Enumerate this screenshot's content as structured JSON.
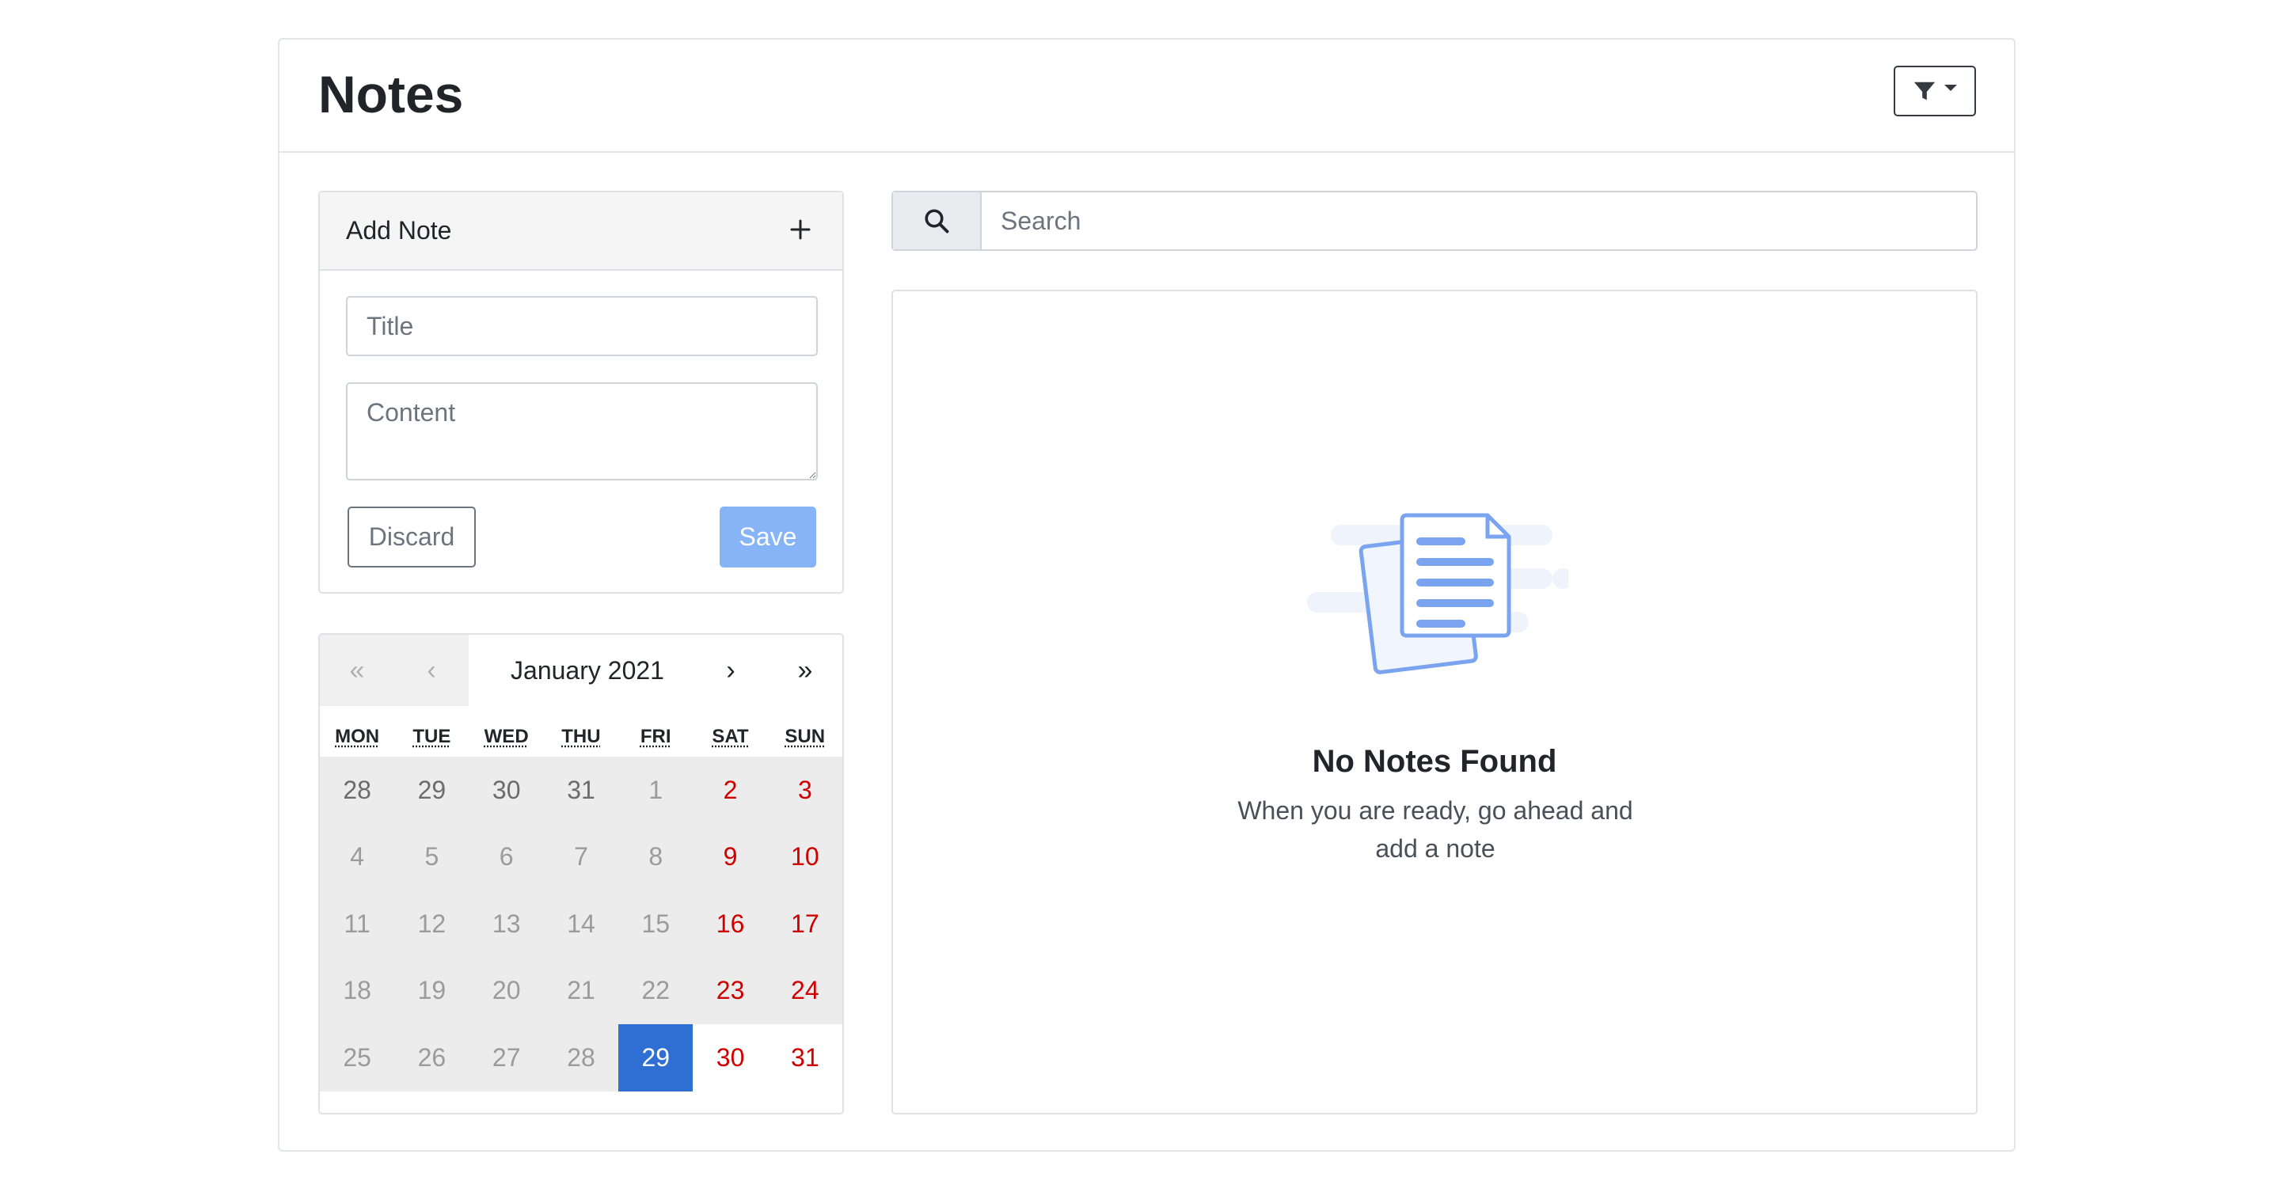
{
  "header": {
    "title": "Notes"
  },
  "add_note": {
    "label": "Add Note",
    "title_placeholder": "Title",
    "content_placeholder": "Content",
    "discard_label": "Discard",
    "save_label": "Save"
  },
  "calendar": {
    "prev_year": "«",
    "prev_month": "‹",
    "month_label": "January 2021",
    "next_month": "›",
    "next_year": "»",
    "weekdays": [
      "MON",
      "TUE",
      "WED",
      "THU",
      "FRI",
      "SAT",
      "SUN"
    ],
    "days": [
      {
        "d": "28",
        "t": "neighbor"
      },
      {
        "d": "29",
        "t": "neighbor"
      },
      {
        "d": "30",
        "t": "neighbor"
      },
      {
        "d": "31",
        "t": "neighbor"
      },
      {
        "d": "1",
        "t": ""
      },
      {
        "d": "2",
        "t": "weekend"
      },
      {
        "d": "3",
        "t": "weekend"
      },
      {
        "d": "4",
        "t": ""
      },
      {
        "d": "5",
        "t": ""
      },
      {
        "d": "6",
        "t": ""
      },
      {
        "d": "7",
        "t": ""
      },
      {
        "d": "8",
        "t": ""
      },
      {
        "d": "9",
        "t": "weekend"
      },
      {
        "d": "10",
        "t": "weekend"
      },
      {
        "d": "11",
        "t": ""
      },
      {
        "d": "12",
        "t": ""
      },
      {
        "d": "13",
        "t": ""
      },
      {
        "d": "14",
        "t": ""
      },
      {
        "d": "15",
        "t": ""
      },
      {
        "d": "16",
        "t": "weekend"
      },
      {
        "d": "17",
        "t": "weekend"
      },
      {
        "d": "18",
        "t": ""
      },
      {
        "d": "19",
        "t": ""
      },
      {
        "d": "20",
        "t": ""
      },
      {
        "d": "21",
        "t": ""
      },
      {
        "d": "22",
        "t": ""
      },
      {
        "d": "23",
        "t": "weekend"
      },
      {
        "d": "24",
        "t": "weekend"
      },
      {
        "d": "25",
        "t": ""
      },
      {
        "d": "26",
        "t": ""
      },
      {
        "d": "27",
        "t": ""
      },
      {
        "d": "28",
        "t": ""
      },
      {
        "d": "29",
        "t": "active"
      },
      {
        "d": "30",
        "t": "weekend future"
      },
      {
        "d": "31",
        "t": "weekend future"
      }
    ]
  },
  "search": {
    "placeholder": "Search"
  },
  "empty_state": {
    "title": "No Notes Found",
    "text": "When you are ready, go ahead and add a note"
  },
  "icons": {
    "filter": "filter-icon",
    "plus": "plus-icon",
    "search": "search-icon",
    "empty": "document-icon"
  },
  "colors": {
    "save_button": "#86b4f7",
    "active_day": "#2f6fd3",
    "weekend_text": "#d10000",
    "illustration": "#7aa4f0"
  }
}
